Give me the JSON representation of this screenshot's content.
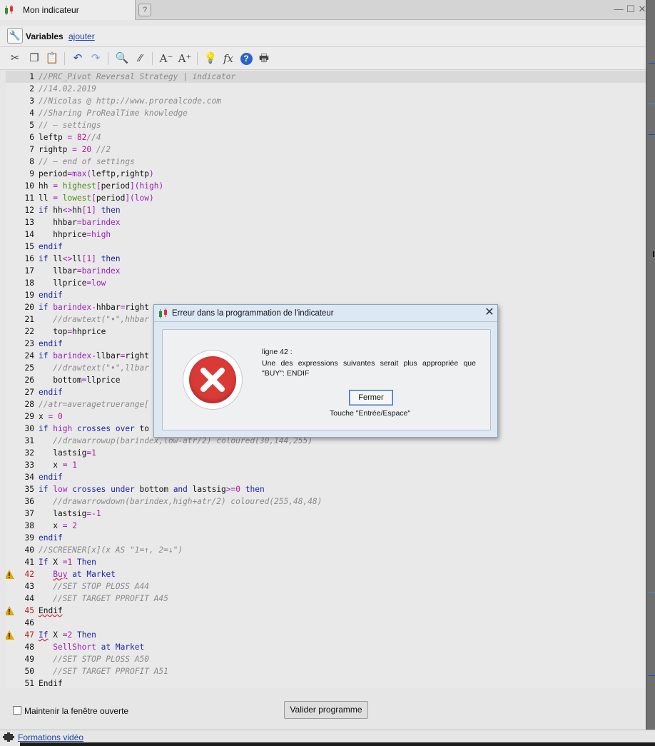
{
  "window": {
    "title": "Mon indicateur",
    "controls": [
      "minimize",
      "restore",
      "close"
    ]
  },
  "variables": {
    "label": "Variables",
    "add_link": "ajouter"
  },
  "toolbar": {
    "icons": [
      "cut-icon",
      "copy-icon",
      "paste-icon",
      "undo-icon",
      "redo-icon",
      "search-icon",
      "comment-icon",
      "font-decrease-icon",
      "font-increase-icon",
      "lightbulb-icon",
      "function-icon",
      "help-icon",
      "print-icon"
    ]
  },
  "editor": {
    "highlighted_line": 1,
    "lines": [
      {
        "n": "1",
        "t": "//PRC_Pivot Reversal Strategy | indicator"
      },
      {
        "n": "2",
        "t": "//14.02.2019"
      },
      {
        "n": "3",
        "t": "//Nicolas @ http://www.prorealcode.com"
      },
      {
        "n": "4",
        "t": "//Sharing ProRealTime knowledge"
      },
      {
        "n": "5",
        "t": "// — settings"
      },
      {
        "n": "6",
        "t": "leftp = 82//4"
      },
      {
        "n": "7",
        "t": "rightp = 20 //2"
      },
      {
        "n": "8",
        "t": "// — end of settings"
      },
      {
        "n": "9",
        "t": "period=max(leftp,rightp)"
      },
      {
        "n": "10",
        "t": "hh = highest[period](high)"
      },
      {
        "n": "11",
        "t": "ll = lowest[period](low)"
      },
      {
        "n": "12",
        "t": "if hh<>hh[1] then"
      },
      {
        "n": "13",
        "t": "   hhbar=barindex"
      },
      {
        "n": "14",
        "t": "   hhprice=high"
      },
      {
        "n": "15",
        "t": "endif"
      },
      {
        "n": "16",
        "t": "if ll<>ll[1] then"
      },
      {
        "n": "17",
        "t": "   llbar=barindex"
      },
      {
        "n": "18",
        "t": "   llprice=low"
      },
      {
        "n": "19",
        "t": "endif"
      },
      {
        "n": "20",
        "t": "if barindex-hhbar=right"
      },
      {
        "n": "21",
        "t": "   //drawtext(\"•\",hhbar"
      },
      {
        "n": "22",
        "t": "   top=hhprice"
      },
      {
        "n": "23",
        "t": "endif"
      },
      {
        "n": "24",
        "t": "if barindex-llbar=right"
      },
      {
        "n": "25",
        "t": "   //drawtext(\"•\",llbar"
      },
      {
        "n": "26",
        "t": "   bottom=llprice"
      },
      {
        "n": "27",
        "t": "endif"
      },
      {
        "n": "28",
        "t": "//atr=averagetruerange["
      },
      {
        "n": "29",
        "t": "x = 0"
      },
      {
        "n": "30",
        "t": "if high crosses over to"
      },
      {
        "n": "31",
        "t": "   //drawarrowup(barindex,low-atr/2) coloured(30,144,255)"
      },
      {
        "n": "32",
        "t": "   lastsig=1"
      },
      {
        "n": "33",
        "t": "   x = 1"
      },
      {
        "n": "34",
        "t": "endif"
      },
      {
        "n": "35",
        "t": "if low crosses under bottom and lastsig>=0 then"
      },
      {
        "n": "36",
        "t": "   //drawarrowdown(barindex,high+atr/2) coloured(255,48,48)"
      },
      {
        "n": "37",
        "t": "   lastsig=-1"
      },
      {
        "n": "38",
        "t": "   x = 2"
      },
      {
        "n": "39",
        "t": "endif"
      },
      {
        "n": "40",
        "t": "//SCREENER[x](x AS \"1=↑, 2=↓\")"
      },
      {
        "n": "41",
        "t": "If X =1 Then"
      },
      {
        "n": "42",
        "t": "   Buy at Market",
        "warn": true
      },
      {
        "n": "43",
        "t": "   //SET STOP PLOSS A44"
      },
      {
        "n": "44",
        "t": "   //SET TARGET PPROFIT A45"
      },
      {
        "n": "45",
        "t": "Endif",
        "warn": true
      },
      {
        "n": "46",
        "t": ""
      },
      {
        "n": "47",
        "t": "If X =2 Then",
        "warn": true
      },
      {
        "n": "48",
        "t": "   SellShort at Market"
      },
      {
        "n": "49",
        "t": "   //SET STOP PLOSS A50"
      },
      {
        "n": "50",
        "t": "   //SET TARGET PPROFIT A51"
      },
      {
        "n": "51",
        "t": "Endif"
      }
    ]
  },
  "footer": {
    "keep_open_label": "Maintenir la fenêtre ouverte",
    "keep_open_checked": false,
    "validate_button": "Valider programme"
  },
  "bottombar": {
    "link": "Formations vidéo"
  },
  "dialog": {
    "title": "Erreur dans la programmation de l'indicateur",
    "line_ref": "ligne 42 :",
    "message": "Une des expressions suivantes serait plus appropriée que \"BUY\": ENDIF",
    "button": "Fermer",
    "hint": "Touche \"Entrée/Espace\""
  },
  "colors": {
    "keyword": "#1e22aa",
    "function": "#9d1fc0",
    "number": "#b5179e",
    "comment": "#8a8a8a",
    "error_red": "#d93a36"
  }
}
